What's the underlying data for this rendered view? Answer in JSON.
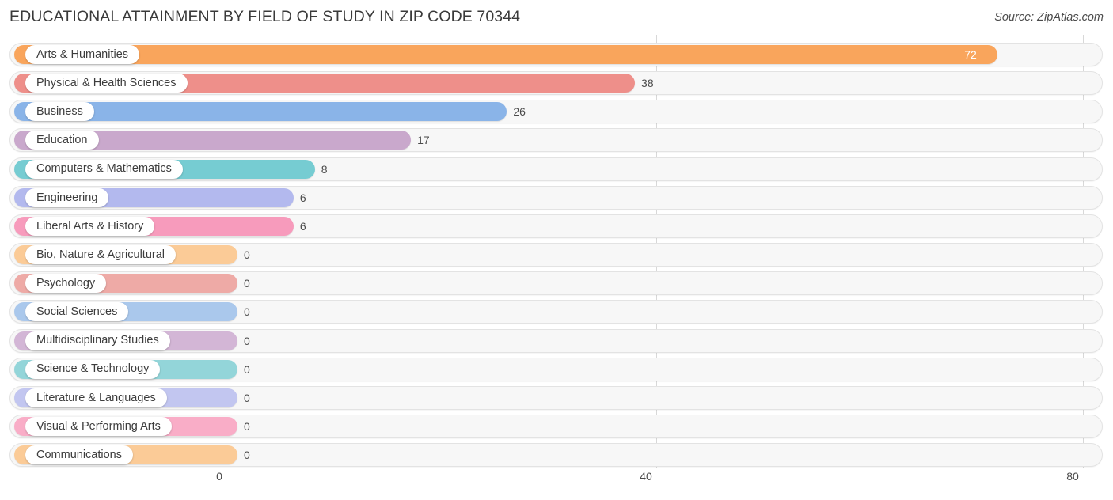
{
  "header": {
    "title": "EDUCATIONAL ATTAINMENT BY FIELD OF STUDY IN ZIP CODE 70344",
    "source": "Source: ZipAtlas.com"
  },
  "chart_data": {
    "type": "bar",
    "orientation": "horizontal",
    "title": "EDUCATIONAL ATTAINMENT BY FIELD OF STUDY IN ZIP CODE 70344",
    "xlabel": "",
    "ylabel": "",
    "xlim": [
      0,
      80
    ],
    "xticks": [
      0,
      40,
      80
    ],
    "xtick_labels": [
      "0",
      "40",
      "80"
    ],
    "grid": true,
    "legend": "none",
    "categories": [
      "Arts & Humanities",
      "Physical & Health Sciences",
      "Business",
      "Education",
      "Computers & Mathematics",
      "Engineering",
      "Liberal Arts & History",
      "Bio, Nature & Agricultural",
      "Psychology",
      "Social Sciences",
      "Multidisciplinary Studies",
      "Science & Technology",
      "Literature & Languages",
      "Visual & Performing Arts",
      "Communications"
    ],
    "values": [
      72,
      38,
      26,
      17,
      8,
      6,
      6,
      0,
      0,
      0,
      0,
      0,
      0,
      0,
      0
    ],
    "value_labels": [
      "72",
      "38",
      "26",
      "17",
      "8",
      "6",
      "6",
      "0",
      "0",
      "0",
      "0",
      "0",
      "0",
      "0",
      "0"
    ],
    "colors": [
      "#f9a55c",
      "#ee8f8a",
      "#8ab4e8",
      "#c9a8cc",
      "#76ccd2",
      "#b3b9ee",
      "#f79bbc",
      "#fbcb97",
      "#eeaaa6",
      "#aac8ec",
      "#d3b6d6",
      "#93d5d9",
      "#c2c6f0",
      "#f9adc7",
      "#fbcb97"
    ]
  },
  "axis": {
    "ticks": [
      {
        "label": "0",
        "value": 0
      },
      {
        "label": "40",
        "value": 40
      },
      {
        "label": "80",
        "value": 80
      }
    ]
  }
}
